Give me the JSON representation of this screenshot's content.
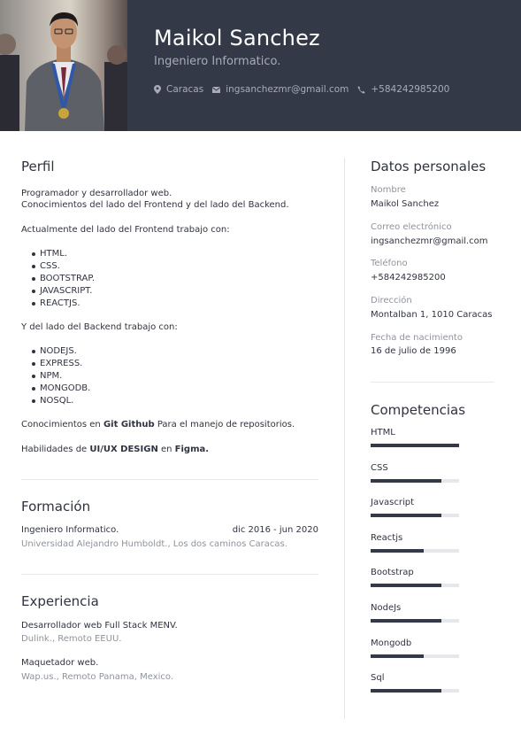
{
  "header": {
    "name": "Maikol Sanchez",
    "role": "Ingeniero Informatico.",
    "contacts": [
      {
        "icon": "map-marker-icon",
        "text": "Caracas"
      },
      {
        "icon": "envelope-icon",
        "text": "ingsanchezmr@gmail.com"
      },
      {
        "icon": "phone-icon",
        "text": "+584242985200"
      }
    ],
    "colors": {
      "band": "#333947",
      "muted": "#a7acb6"
    }
  },
  "perfil": {
    "title": "Perfil",
    "intro_1": "Programador y desarrollador web.",
    "intro_2": "Conocimientos del lado del Frontend y del lado del Backend.",
    "frontend_intro": "Actualmente del lado del Frontend trabajo con:",
    "frontend": [
      "HTML.",
      "CSS.",
      "BOOTSTRAP.",
      "JAVASCRIPT.",
      "REACTJS."
    ],
    "backend_intro": "Y del lado del Backend trabajo con:",
    "backend": [
      "NODEJS.",
      "EXPRESS.",
      "NPM.",
      "MONGODB.",
      "NOSQL."
    ],
    "git_pre": "Conocimientos en ",
    "git_bold": "Git Github",
    "git_post": "  Para el manejo de repositorios.",
    "ux_pre": "Habilidades de ",
    "ux_bold_1": "UI/UX DESIGN",
    "ux_mid": " en ",
    "ux_bold_2": "Figma."
  },
  "formacion": {
    "title": "Formación",
    "degree": "Ingeniero Informatico.",
    "dates": "dic 2016 - jun 2020",
    "school": "Universidad Alejandro Humboldt., Los dos caminos Caracas."
  },
  "experiencia": {
    "title": "Experiencia",
    "jobs": [
      {
        "role": "Desarrollador web Full Stack MENV.",
        "place": "Dulink., Remoto EEUU."
      },
      {
        "role": "Maquetador web.",
        "place": "Wap.us., Remoto Panama, Mexico."
      }
    ]
  },
  "datos": {
    "title": "Datos personales",
    "fields": [
      {
        "label": "Nombre",
        "value": "Maikol Sanchez"
      },
      {
        "label": "Correo electrónico",
        "value": "ingsanchezmr@gmail.com"
      },
      {
        "label": "Teléfono",
        "value": "+584242985200"
      },
      {
        "label": "Dirección",
        "value": "Montalban 1, 1010 Caracas"
      },
      {
        "label": "Fecha de nacimiento",
        "value": "16 de julio de 1996"
      }
    ]
  },
  "competencias": {
    "title": "Competencias",
    "skills": [
      {
        "name": "HTML",
        "level": 1.0
      },
      {
        "name": "CSS",
        "level": 0.8
      },
      {
        "name": "Javascript",
        "level": 0.8
      },
      {
        "name": "Reactjs",
        "level": 0.6
      },
      {
        "name": "Bootstrap",
        "level": 0.8
      },
      {
        "name": "NodeJs",
        "level": 0.8
      },
      {
        "name": "Mongodb",
        "level": 0.6
      },
      {
        "name": "Sql",
        "level": 0.8
      }
    ]
  }
}
